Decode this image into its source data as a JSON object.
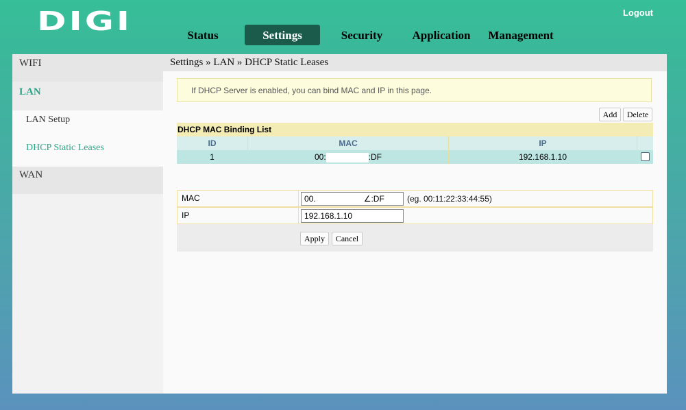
{
  "header": {
    "logo": "DIGI",
    "logout": "Logout"
  },
  "nav": {
    "tabs": [
      "Status",
      "Settings",
      "Security",
      "Application",
      "Management"
    ],
    "active": "Settings"
  },
  "sidebar": {
    "wifi": "WIFI",
    "lan": "LAN",
    "lan_setup": "LAN Setup",
    "dhcp_static": "DHCP Static Leases",
    "wan": "WAN"
  },
  "breadcrumb": "Settings » LAN » DHCP Static Leases",
  "note": "If DHCP Server is enabled, you can bind MAC and IP in this page.",
  "toolbar": {
    "add": "Add",
    "delete": "Delete"
  },
  "binding_list": {
    "title": "DHCP MAC Binding List",
    "columns": [
      "ID",
      "MAC",
      "IP"
    ],
    "rows": [
      {
        "id": "1",
        "mac_prefix": "00:",
        "mac_suffix": ":DF",
        "ip": "192.168.1.10"
      }
    ]
  },
  "form": {
    "mac_label": "MAC",
    "mac_value_prefix": "00.",
    "mac_value_suffix": "∠:DF",
    "mac_hint": "(eg. 00:11:22:33:44:55)",
    "ip_label": "IP",
    "ip_value": "192.168.1.10",
    "apply": "Apply",
    "cancel": "Cancel"
  }
}
